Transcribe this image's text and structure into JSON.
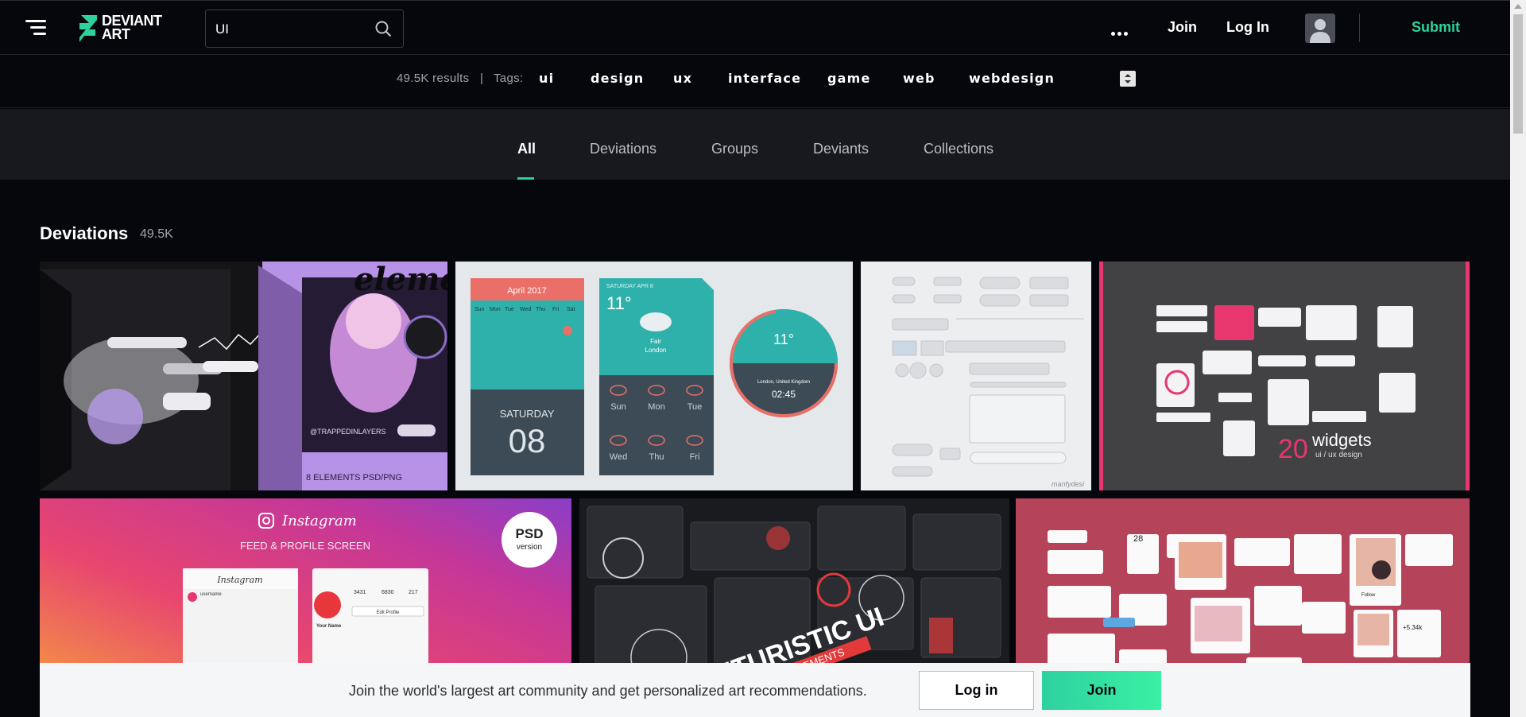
{
  "header": {
    "menu_icon": "hamburger-menu-icon",
    "logo_line1": "DEVIANT",
    "logo_line2": "ART",
    "search_value": "UI",
    "search_icon": "search-icon",
    "more_icon": "more-horizontal-icon",
    "join_label": "Join",
    "login_label": "Log In",
    "avatar_icon": "user-avatar-icon",
    "submit_label": "Submit",
    "accent_color": "#2ed199"
  },
  "tagbar": {
    "results": "49.5K results",
    "separator": "|",
    "tags_label": "Tags:",
    "tags": [
      "ui",
      "design",
      "ux",
      "interface",
      "game",
      "web",
      "webdesign"
    ]
  },
  "tabs": [
    {
      "label": "All",
      "active": true
    },
    {
      "label": "Deviations"
    },
    {
      "label": "Groups"
    },
    {
      "label": "Deviants"
    },
    {
      "label": "Collections"
    }
  ],
  "section": {
    "title": "Deviations",
    "count": "49.5K"
  },
  "thumbs": {
    "t1": {
      "title_top": "elements",
      "caption": "8 ELEMENTS PSD/PNG",
      "credit": "@TRAPPEDINLAYERS"
    },
    "t2": {
      "month": "April 2017",
      "weekdays": [
        "Sun",
        "Mon",
        "Tue",
        "Wed",
        "Thu",
        "Fri",
        "Sat"
      ],
      "day_name": "SATURDAY",
      "day_number": "08",
      "weather_date": "SATURDAY APR 8",
      "temp": "11°",
      "condition": "Fair",
      "city": "London",
      "days_row1": [
        "Sun",
        "Mon",
        "Tue"
      ],
      "days_row2": [
        "Wed",
        "Thu",
        "Fri"
      ],
      "dial_temp": "11°",
      "dial_city": "London, United Kingdom",
      "dial_time": "02:45"
    },
    "t3": {
      "signature": "manfydesi"
    },
    "t4": {
      "big_number": "20",
      "big_word": "widgets",
      "subtitle": "ui / ux design"
    },
    "t5": {
      "brand": "Instagram",
      "subtitle": "FEED & PROFILE SCREEN",
      "badge_line1": "PSD",
      "badge_line2": "version",
      "phone_header": "Instagram",
      "username": "username",
      "edit_profile": "Edit Profile",
      "your_name": "Your Name",
      "stats": [
        "3431",
        "6830",
        "217"
      ]
    },
    "t6": {
      "title": "FUTURISTIC UI",
      "subtitle": "DESIGN ELEMENTS"
    },
    "t7": {
      "number": "28",
      "price": "+5.34k",
      "follow": "Follow"
    }
  },
  "banner": {
    "text": "Join the world's largest art community and get personalized art recommendations.",
    "login_label": "Log in",
    "join_label": "Join"
  }
}
